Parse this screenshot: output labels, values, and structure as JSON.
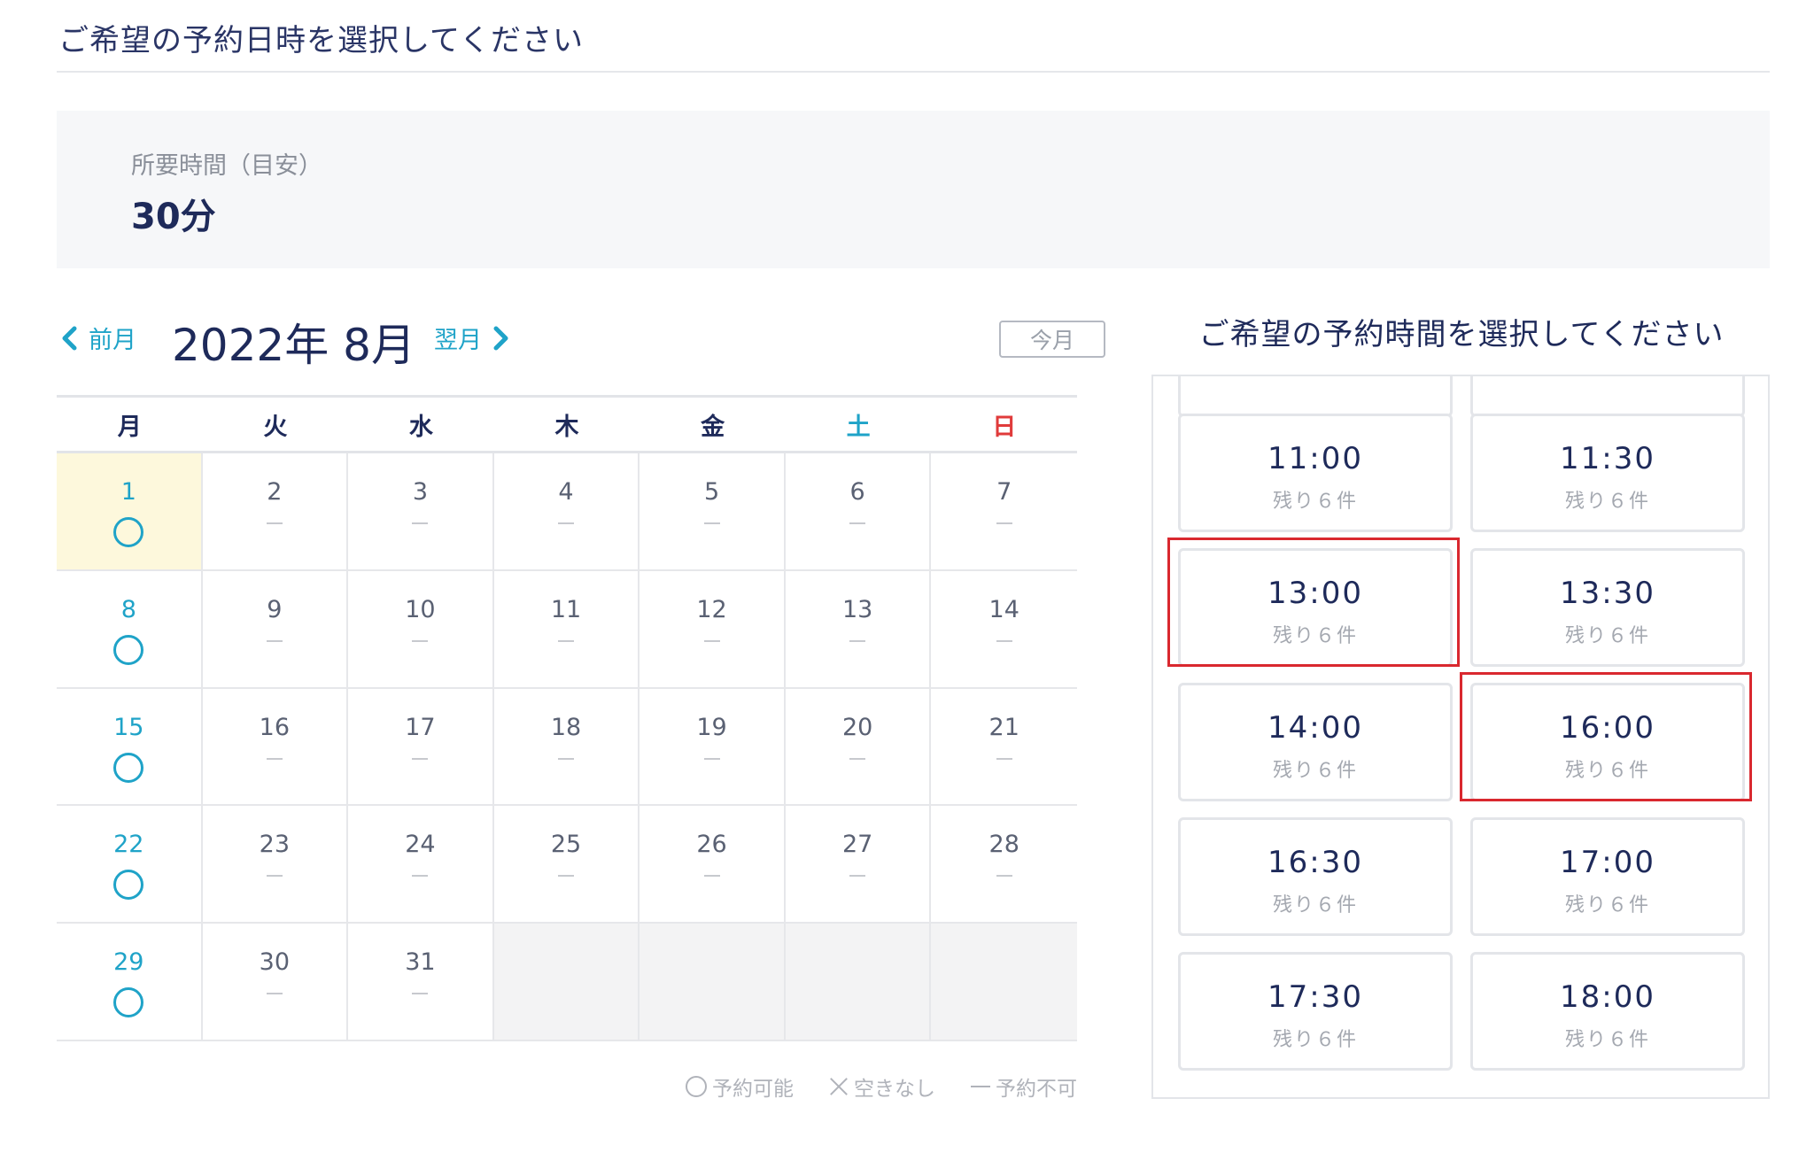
{
  "header": {
    "title": "ご希望の予約日時を選択してください"
  },
  "duration": {
    "label": "所要時間（目安）",
    "value": "30分"
  },
  "calendar": {
    "prev_label": "前月",
    "next_label": "翌月",
    "month_title": "2022年 8月",
    "today_label": "今月",
    "weekdays": [
      "月",
      "火",
      "水",
      "木",
      "金",
      "土",
      "日"
    ],
    "available_days": [
      1,
      8,
      15,
      22,
      29
    ],
    "selected_day": 1,
    "days": [
      "1",
      "2",
      "3",
      "4",
      "5",
      "6",
      "7",
      "8",
      "9",
      "10",
      "11",
      "12",
      "13",
      "14",
      "15",
      "16",
      "17",
      "18",
      "19",
      "20",
      "21",
      "22",
      "23",
      "24",
      "25",
      "26",
      "27",
      "28",
      "29",
      "30",
      "31"
    ]
  },
  "legend": {
    "available": "予約可能",
    "full": "空きなし",
    "unavailable": "予約不可"
  },
  "times": {
    "title": "ご希望の予約時間を選択してください",
    "slots": [
      {
        "time": "11:00",
        "remaining": "残り６件"
      },
      {
        "time": "11:30",
        "remaining": "残り６件"
      },
      {
        "time": "13:00",
        "remaining": "残り６件"
      },
      {
        "time": "13:30",
        "remaining": "残り６件"
      },
      {
        "time": "14:00",
        "remaining": "残り６件"
      },
      {
        "time": "16:00",
        "remaining": "残り６件"
      },
      {
        "time": "16:30",
        "remaining": "残り６件"
      },
      {
        "time": "17:00",
        "remaining": "残り６件"
      },
      {
        "time": "17:30",
        "remaining": "残り６件"
      },
      {
        "time": "18:00",
        "remaining": "残り６件"
      }
    ],
    "highlighted": [
      "13:00",
      "16:00"
    ]
  },
  "colors": {
    "accent": "#1fa3c8",
    "navy": "#1e2a5a",
    "sunday": "#e03b3b",
    "highlight": "#d9282f",
    "selected_bg": "#fdf8dc"
  }
}
